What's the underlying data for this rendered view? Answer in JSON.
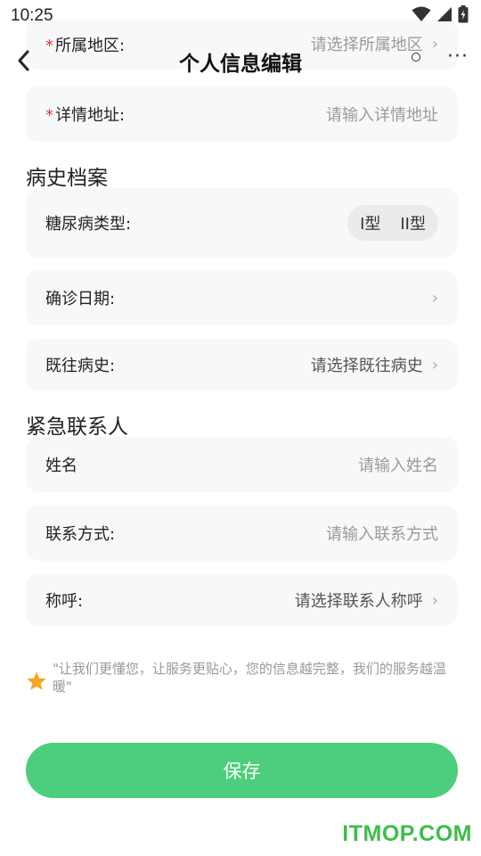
{
  "status_bar": {
    "time": "10:25"
  },
  "nav": {
    "title": "个人信息编辑"
  },
  "address": {
    "region": {
      "label": "所属地区:",
      "placeholder": "请选择所属地区"
    },
    "detail": {
      "label": "详情地址:",
      "placeholder": "请输入详情地址"
    }
  },
  "medical": {
    "section_title": "病史档案",
    "diabetes_type": {
      "label": "糖尿病类型:",
      "options": [
        "I型",
        "II型"
      ]
    },
    "diagnosis_date": {
      "label": "确诊日期:",
      "value": ""
    },
    "history": {
      "label": "既往病史:",
      "placeholder": "请选择既往病史"
    }
  },
  "emergency": {
    "section_title": "紧急联系人",
    "name": {
      "label": "姓名",
      "placeholder": "请输入姓名"
    },
    "contact": {
      "label": "联系方式:",
      "placeholder": "请输入联系方式"
    },
    "relation": {
      "label": "称呼:",
      "placeholder": "请选择联系人称呼"
    }
  },
  "tip": {
    "text": "\"让我们更懂您，让服务更贴心，您的信息越完整，我们的服务越温暖\""
  },
  "save_label": "保存",
  "watermark": "ITMOP.COM",
  "colors": {
    "accent": "#4cce7c",
    "required": "#e53935",
    "star": "#f5a623",
    "watermark": "#3ebd4a"
  }
}
